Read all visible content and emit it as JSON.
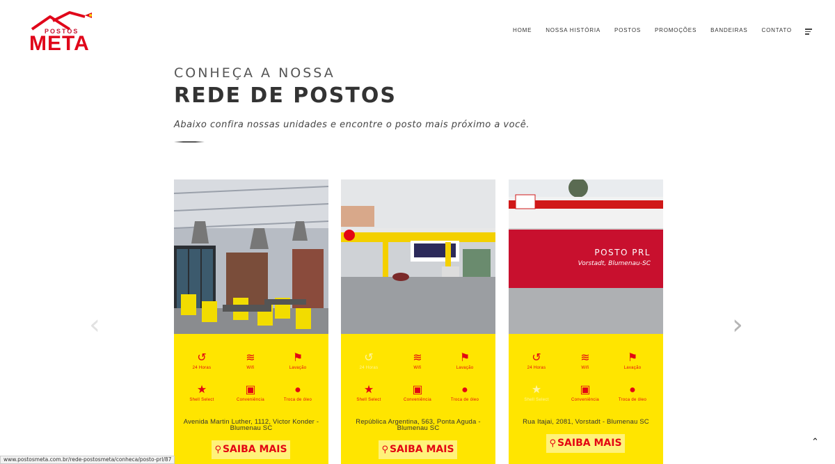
{
  "brand": {
    "top": "POSTOS",
    "name": "META"
  },
  "nav": {
    "items": [
      "HOME",
      "NOSSA HISTÓRIA",
      "POSTOS",
      "PROMOÇÕES",
      "BANDEIRAS",
      "CONTATO"
    ]
  },
  "hero": {
    "kicker": "CONHEÇA A NOSSA",
    "title": "REDE DE POSTOS",
    "subtitle": "Abaixo confira nossas unidades e encontre o posto mais próximo a você."
  },
  "features": {
    "hours": "24 Horas",
    "wifi": "Wifi",
    "wash": "Lavação",
    "shell": "Shell Select",
    "store": "Conveniência",
    "oil": "Troca de óleo"
  },
  "cards": [
    {
      "address": "Avenida Martin Luther, 1112, Victor Konder - Blumenau SC",
      "button": "SAIBA MAIS"
    },
    {
      "address": "República Argentina, 563, Ponta Aguda - Blumenau SC",
      "button": "SAIBA MAIS"
    },
    {
      "name": "POSTO PRL",
      "city": "Vorstadt, Blumenau-SC",
      "address": "Rua Itajai, 2081, Vorstadt - Blumenau SC",
      "button": "SAIBA MAIS"
    }
  ],
  "statusbar": "www.postosmeta.com.br/rede-postosmeta/conheca/posto-prl/87",
  "colors": {
    "accent": "#e30613",
    "card": "#ffe500",
    "overlay": "#c8102e"
  },
  "icons": [
    "history-icon",
    "wifi-icon",
    "wash-icon",
    "star-icon",
    "store-icon",
    "drop-icon",
    "map-pin-icon",
    "chevron-left-icon",
    "chevron-right-icon",
    "menu-icon",
    "chevron-up-icon"
  ]
}
